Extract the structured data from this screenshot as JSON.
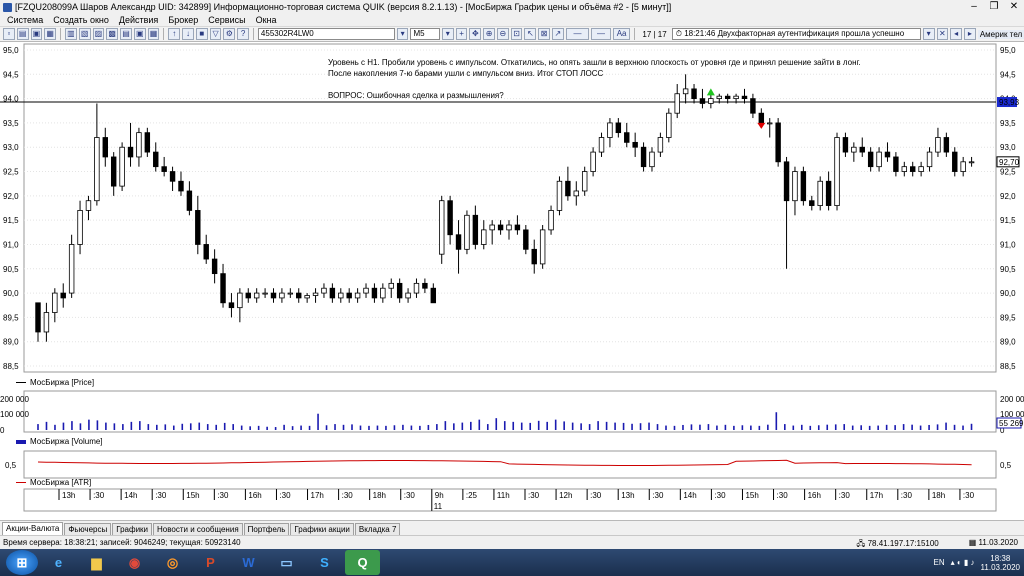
{
  "window": {
    "title": "[FZQU208099A Шаров Александр UID: 342899] Информационно-торговая система QUIK (версия 8.2.1.13) - [МосБиржа График цены и объёма #2 - [5 минут]]",
    "minimize_icon": "minimize-icon",
    "restore_icon": "restore-icon",
    "close_icon": "close-icon"
  },
  "menu": [
    "Система",
    "Создать окно",
    "Действия",
    "Брокер",
    "Сервисы",
    "Окна"
  ],
  "toolbar": {
    "instrument": "455302R4LW0",
    "interval": "M5",
    "counter": "17 | 17",
    "alert_time": "18:21:46",
    "alert_text": "Двухфакторная аутентификация прошла успешно",
    "right_stub": "Америк тел"
  },
  "chart": {
    "annotation": [
      "Уровень с Н1. Пробили уровень с импульсом. Откатились, но опять зашли в верхнюю плоскость от уровня где и принял решение зайти в лонг.",
      "После накопления 7-ю барами ушли с импульсом вниз. Итог СТОП ЛОСС",
      "",
      "ВОПРОС: Ошибочная сделка и размышления?"
    ],
    "price_legend": "МосБиржа [Price]",
    "volume_legend": "МосБиржа [Volume]",
    "atr_legend": "МосБиржа [ATR]",
    "price_ticks": [
      "95,0",
      "94,5",
      "94,0",
      "93,5",
      "93,0",
      "92,5",
      "92,0",
      "91,5",
      "91,0",
      "90,5",
      "90,0",
      "89,5",
      "89,0",
      "88,5"
    ],
    "level_label": "93,93",
    "last_price_label": "92,70",
    "volume_ticks_left": [
      "200 000",
      "100 000",
      "0"
    ],
    "volume_ticks_right": [
      "200 000",
      "100 000",
      "0"
    ],
    "volume_last_label": "55 269",
    "atr_tick": "0,5",
    "time_labels": [
      "13h",
      ":30",
      "14h",
      ":30",
      "15h",
      ":30",
      "16h",
      ":30",
      "17h",
      ":30",
      "18h",
      ":30",
      "9h",
      ":25",
      "11h",
      ":30",
      "12h",
      ":30",
      "13h",
      ":30",
      "14h",
      ":30",
      "15h",
      ":30",
      "16h",
      ":30",
      "17h",
      ":30",
      "18h",
      ":30"
    ],
    "date_label": "11"
  },
  "chart_data": {
    "type": "candlestick",
    "ylim": [
      88.5,
      95.0
    ],
    "level": 93.93,
    "last_price": 92.7,
    "ohlc": [
      [
        89.8,
        89.5,
        89.0,
        89.2
      ],
      [
        89.2,
        89.8,
        89.0,
        89.6
      ],
      [
        89.6,
        90.1,
        89.4,
        90.0
      ],
      [
        90.0,
        90.2,
        89.7,
        89.9
      ],
      [
        90.0,
        91.2,
        89.9,
        91.0
      ],
      [
        91.0,
        91.9,
        90.8,
        91.7
      ],
      [
        91.7,
        92.0,
        91.5,
        91.9
      ],
      [
        91.9,
        93.9,
        91.8,
        93.2
      ],
      [
        93.2,
        93.4,
        92.6,
        92.8
      ],
      [
        92.8,
        92.9,
        92.0,
        92.2
      ],
      [
        92.2,
        93.1,
        92.1,
        93.0
      ],
      [
        93.0,
        93.5,
        92.6,
        92.8
      ],
      [
        92.8,
        93.4,
        92.6,
        93.3
      ],
      [
        93.3,
        93.4,
        92.8,
        92.9
      ],
      [
        92.9,
        93.1,
        92.5,
        92.6
      ],
      [
        92.6,
        92.8,
        92.4,
        92.5
      ],
      [
        92.5,
        92.6,
        92.1,
        92.3
      ],
      [
        92.3,
        92.5,
        92.0,
        92.1
      ],
      [
        92.1,
        92.3,
        91.6,
        91.7
      ],
      [
        91.7,
        92.0,
        90.8,
        91.0
      ],
      [
        91.0,
        91.2,
        90.6,
        90.7
      ],
      [
        90.7,
        90.9,
        90.2,
        90.4
      ],
      [
        90.4,
        90.6,
        89.7,
        89.8
      ],
      [
        89.8,
        90.0,
        89.5,
        89.7
      ],
      [
        89.7,
        90.1,
        89.4,
        90.0
      ],
      [
        90.0,
        90.1,
        89.8,
        89.9
      ],
      [
        89.9,
        90.1,
        89.8,
        90.0
      ],
      [
        90.0,
        90.1,
        89.9,
        90.0
      ],
      [
        90.0,
        90.1,
        89.8,
        89.9
      ],
      [
        89.9,
        90.1,
        89.8,
        90.0
      ],
      [
        90.0,
        90.1,
        89.9,
        90.0
      ],
      [
        90.0,
        90.1,
        89.8,
        89.9
      ],
      [
        89.9,
        90.0,
        89.8,
        89.95
      ],
      [
        89.95,
        90.1,
        89.8,
        90.0
      ],
      [
        90.0,
        90.2,
        89.9,
        90.1
      ],
      [
        90.1,
        90.2,
        89.8,
        89.9
      ],
      [
        89.9,
        90.1,
        89.8,
        90.0
      ],
      [
        90.0,
        90.1,
        89.8,
        89.9
      ],
      [
        89.9,
        90.1,
        89.8,
        90.0
      ],
      [
        90.0,
        90.2,
        89.9,
        90.1
      ],
      [
        90.1,
        90.2,
        89.8,
        89.9
      ],
      [
        89.9,
        90.2,
        89.8,
        90.1
      ],
      [
        90.1,
        90.3,
        89.9,
        90.2
      ],
      [
        90.2,
        90.3,
        89.8,
        89.9
      ],
      [
        89.9,
        90.1,
        89.8,
        90.0
      ],
      [
        90.0,
        90.3,
        89.9,
        90.2
      ],
      [
        90.2,
        90.3,
        90.0,
        90.1
      ],
      [
        90.1,
        90.2,
        89.8,
        89.8
      ],
      [
        90.8,
        92.0,
        90.6,
        91.9
      ],
      [
        91.9,
        92.0,
        91.0,
        91.2
      ],
      [
        91.2,
        91.5,
        90.4,
        90.9
      ],
      [
        90.9,
        91.7,
        90.8,
        91.6
      ],
      [
        91.6,
        91.8,
        90.9,
        91.0
      ],
      [
        91.0,
        91.5,
        90.9,
        91.3
      ],
      [
        91.3,
        91.5,
        91.0,
        91.4
      ],
      [
        91.4,
        91.5,
        91.2,
        91.3
      ],
      [
        91.3,
        91.5,
        91.1,
        91.4
      ],
      [
        91.4,
        91.6,
        91.2,
        91.3
      ],
      [
        91.3,
        91.4,
        90.8,
        90.9
      ],
      [
        90.9,
        91.1,
        90.4,
        90.6
      ],
      [
        90.6,
        91.4,
        90.5,
        91.3
      ],
      [
        91.3,
        91.8,
        91.2,
        91.7
      ],
      [
        91.7,
        92.4,
        91.6,
        92.3
      ],
      [
        92.3,
        92.6,
        91.9,
        92.0
      ],
      [
        92.0,
        92.3,
        91.8,
        92.1
      ],
      [
        92.1,
        92.6,
        92.0,
        92.5
      ],
      [
        92.5,
        93.0,
        92.4,
        92.9
      ],
      [
        92.9,
        93.3,
        92.8,
        93.2
      ],
      [
        93.2,
        93.6,
        93.0,
        93.5
      ],
      [
        93.5,
        93.6,
        93.2,
        93.3
      ],
      [
        93.3,
        93.5,
        93.0,
        93.1
      ],
      [
        93.1,
        93.3,
        92.8,
        93.0
      ],
      [
        93.0,
        93.1,
        92.5,
        92.6
      ],
      [
        92.6,
        93.0,
        92.5,
        92.9
      ],
      [
        92.9,
        93.3,
        92.8,
        93.2
      ],
      [
        93.2,
        93.8,
        93.1,
        93.7
      ],
      [
        93.7,
        94.3,
        93.6,
        94.1
      ],
      [
        94.1,
        94.5,
        93.9,
        94.2
      ],
      [
        94.2,
        94.3,
        93.9,
        94.0
      ],
      [
        94.0,
        94.2,
        93.8,
        93.9
      ],
      [
        93.9,
        94.1,
        93.8,
        94.0
      ],
      [
        94.0,
        94.1,
        93.9,
        94.05
      ],
      [
        94.05,
        94.1,
        93.9,
        94.0
      ],
      [
        94.0,
        94.1,
        93.9,
        94.05
      ],
      [
        94.05,
        94.2,
        93.9,
        94.0
      ],
      [
        94.0,
        94.1,
        93.6,
        93.7
      ],
      [
        93.7,
        93.8,
        93.4,
        93.5
      ],
      [
        93.5,
        93.6,
        93.2,
        93.5
      ],
      [
        93.5,
        93.6,
        92.6,
        92.7
      ],
      [
        92.7,
        92.8,
        90.5,
        91.9
      ],
      [
        91.9,
        92.6,
        91.6,
        92.5
      ],
      [
        92.5,
        92.6,
        91.8,
        91.9
      ],
      [
        91.9,
        92.0,
        91.7,
        91.8
      ],
      [
        91.8,
        92.4,
        91.7,
        92.3
      ],
      [
        92.3,
        92.5,
        91.7,
        91.8
      ],
      [
        91.8,
        93.3,
        91.7,
        93.2
      ],
      [
        93.2,
        93.3,
        92.8,
        92.9
      ],
      [
        92.9,
        93.1,
        92.7,
        93.0
      ],
      [
        93.0,
        93.2,
        92.8,
        92.9
      ],
      [
        92.9,
        93.0,
        92.5,
        92.6
      ],
      [
        92.6,
        93.0,
        92.5,
        92.9
      ],
      [
        92.9,
        93.1,
        92.7,
        92.8
      ],
      [
        92.8,
        92.9,
        92.4,
        92.5
      ],
      [
        92.5,
        92.7,
        92.4,
        92.6
      ],
      [
        92.6,
        92.7,
        92.4,
        92.5
      ],
      [
        92.5,
        92.7,
        92.4,
        92.6
      ],
      [
        92.6,
        93.0,
        92.5,
        92.9
      ],
      [
        92.9,
        93.4,
        92.8,
        93.2
      ],
      [
        93.2,
        93.3,
        92.8,
        92.9
      ],
      [
        92.9,
        93.0,
        92.4,
        92.5
      ],
      [
        92.5,
        92.8,
        92.4,
        92.7
      ],
      [
        92.7,
        92.8,
        92.6,
        92.7
      ]
    ],
    "volume": [
      40,
      55,
      35,
      50,
      60,
      45,
      70,
      65,
      50,
      45,
      40,
      55,
      60,
      40,
      35,
      38,
      30,
      42,
      45,
      50,
      40,
      35,
      48,
      40,
      30,
      25,
      28,
      22,
      20,
      35,
      26,
      30,
      28,
      110,
      32,
      40,
      35,
      38,
      30,
      28,
      30,
      28,
      32,
      35,
      30,
      28,
      34,
      40,
      60,
      45,
      50,
      55,
      70,
      40,
      80,
      60,
      55,
      50,
      48,
      62,
      55,
      70,
      58,
      50,
      45,
      40,
      60,
      55,
      50,
      48,
      42,
      46,
      50,
      40,
      30,
      28,
      34,
      38,
      36,
      40,
      30,
      35,
      28,
      32,
      30,
      28,
      36,
      120,
      40,
      30,
      35,
      28,
      32,
      36,
      38,
      40,
      30,
      32,
      28,
      30,
      35,
      33,
      40,
      36,
      30,
      34,
      38,
      50,
      35,
      30,
      42
    ]
  },
  "tabs": [
    "Акции-Валюта",
    "Фьючерсы",
    "Графики",
    "Новости и сообщения",
    "Портфель",
    "Графики акции",
    "Вкладка 7"
  ],
  "status": {
    "left": "Время сервера: 18:38:21; записей: 9046249; текущая: 50923140",
    "ip": "78.41.197.17:15100",
    "date": "11.03.2020"
  },
  "taskbar": {
    "lang": "EN",
    "time": "18:38",
    "date": "11.03.2020"
  }
}
